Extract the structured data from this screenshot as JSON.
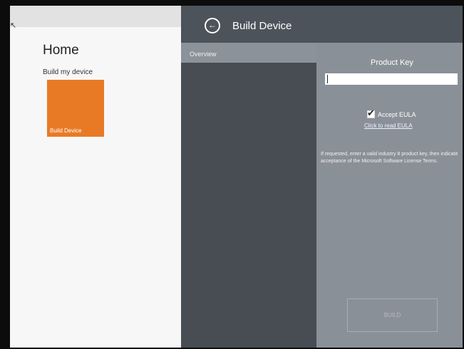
{
  "home": {
    "title": "Home",
    "section_label": "Build my device",
    "tile_label": "Build Device",
    "tile_color": "#e97a25"
  },
  "build_device": {
    "title": "Build Device",
    "back_icon": "arrow-left-circle-icon",
    "overview_label": "Overview",
    "product_key_label": "Product Key",
    "product_key_value": "",
    "accept_eula_label": "Accept EULA",
    "accept_eula_checked": true,
    "eula_link": "Click to read EULA",
    "info_text": "If requested, enter a valid industry 8 product key, then indicate acceptance of the Microsoft Software License Terms.",
    "build_button_label": "BUILD"
  }
}
